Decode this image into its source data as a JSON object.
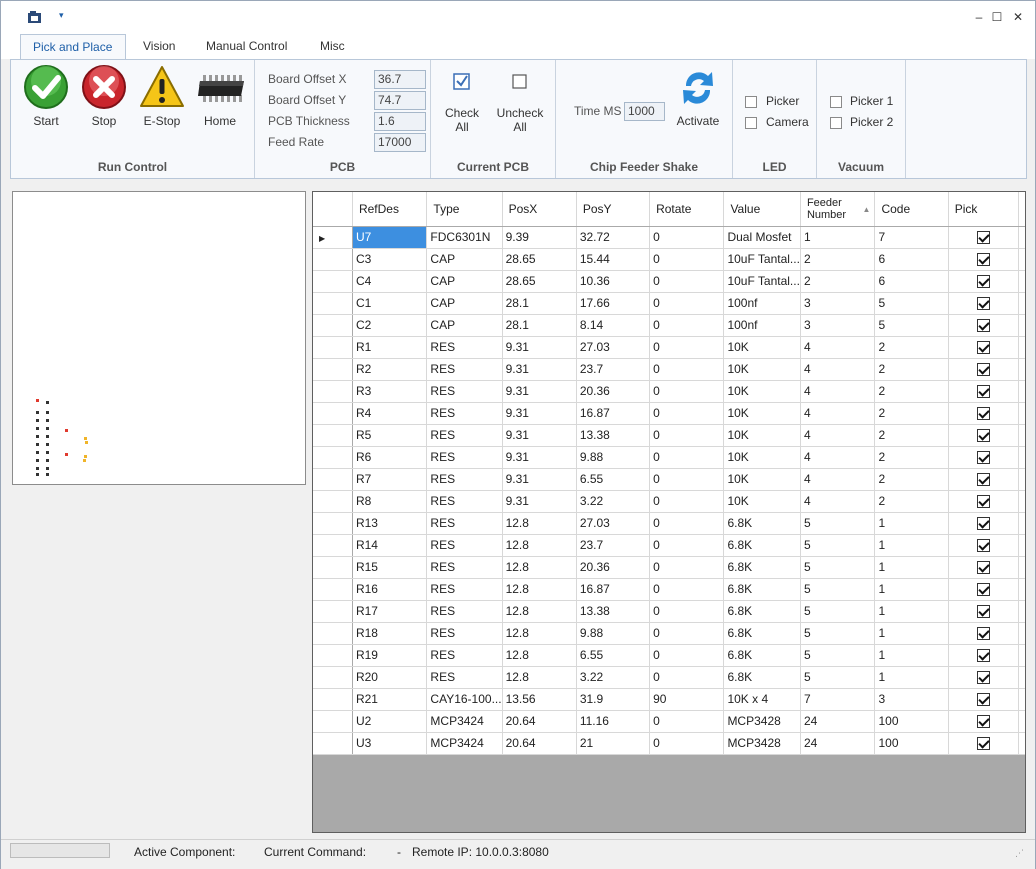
{
  "tabs": [
    "Pick and Place",
    "Vision",
    "Manual Control",
    "Misc"
  ],
  "run_control": {
    "label": "Run Control",
    "start": "Start",
    "stop": "Stop",
    "estop": "E-Stop",
    "home": "Home"
  },
  "pcb": {
    "label": "PCB",
    "board_offset_x_label": "Board Offset X",
    "board_offset_x": "36.7",
    "board_offset_y_label": "Board Offset Y",
    "board_offset_y": "74.7",
    "pcb_thickness_label": "PCB Thickness",
    "pcb_thickness": "1.6",
    "feed_rate_label": "Feed Rate",
    "feed_rate": "17000"
  },
  "current_pcb": {
    "label": "Current PCB",
    "check_all_line1": "Check",
    "check_all_line2": "All",
    "uncheck_all_line1": "Uncheck",
    "uncheck_all_line2": "All"
  },
  "chip_feeder": {
    "label": "Chip Feeder Shake",
    "time_ms_label": "Time MS",
    "time_ms": "1000",
    "activate": "Activate"
  },
  "led": {
    "label": "LED",
    "picker": "Picker",
    "camera": "Camera"
  },
  "vacuum": {
    "label": "Vacuum",
    "picker1": "Picker 1",
    "picker2": "Picker 2"
  },
  "grid": {
    "columns": [
      "RefDes",
      "Type",
      "PosX",
      "PosY",
      "Rotate",
      "Value",
      "Feeder Number",
      "Code",
      "Pick"
    ],
    "rows": [
      [
        "U7",
        "FDC6301N",
        "9.39",
        "32.72",
        "0",
        "Dual Mosfet",
        "1",
        "7",
        true
      ],
      [
        "C3",
        "CAP",
        "28.65",
        "15.44",
        "0",
        "10uF Tantal...",
        "2",
        "6",
        true
      ],
      [
        "C4",
        "CAP",
        "28.65",
        "10.36",
        "0",
        "10uF Tantal...",
        "2",
        "6",
        true
      ],
      [
        "C1",
        "CAP",
        "28.1",
        "17.66",
        "0",
        "100nf",
        "3",
        "5",
        true
      ],
      [
        "C2",
        "CAP",
        "28.1",
        "8.14",
        "0",
        "100nf",
        "3",
        "5",
        true
      ],
      [
        "R1",
        "RES",
        "9.31",
        "27.03",
        "0",
        "10K",
        "4",
        "2",
        true
      ],
      [
        "R2",
        "RES",
        "9.31",
        "23.7",
        "0",
        "10K",
        "4",
        "2",
        true
      ],
      [
        "R3",
        "RES",
        "9.31",
        "20.36",
        "0",
        "10K",
        "4",
        "2",
        true
      ],
      [
        "R4",
        "RES",
        "9.31",
        "16.87",
        "0",
        "10K",
        "4",
        "2",
        true
      ],
      [
        "R5",
        "RES",
        "9.31",
        "13.38",
        "0",
        "10K",
        "4",
        "2",
        true
      ],
      [
        "R6",
        "RES",
        "9.31",
        "9.88",
        "0",
        "10K",
        "4",
        "2",
        true
      ],
      [
        "R7",
        "RES",
        "9.31",
        "6.55",
        "0",
        "10K",
        "4",
        "2",
        true
      ],
      [
        "R8",
        "RES",
        "9.31",
        "3.22",
        "0",
        "10K",
        "4",
        "2",
        true
      ],
      [
        "R13",
        "RES",
        "12.8",
        "27.03",
        "0",
        "6.8K",
        "5",
        "1",
        true
      ],
      [
        "R14",
        "RES",
        "12.8",
        "23.7",
        "0",
        "6.8K",
        "5",
        "1",
        true
      ],
      [
        "R15",
        "RES",
        "12.8",
        "20.36",
        "0",
        "6.8K",
        "5",
        "1",
        true
      ],
      [
        "R16",
        "RES",
        "12.8",
        "16.87",
        "0",
        "6.8K",
        "5",
        "1",
        true
      ],
      [
        "R17",
        "RES",
        "12.8",
        "13.38",
        "0",
        "6.8K",
        "5",
        "1",
        true
      ],
      [
        "R18",
        "RES",
        "12.8",
        "9.88",
        "0",
        "6.8K",
        "5",
        "1",
        true
      ],
      [
        "R19",
        "RES",
        "12.8",
        "6.55",
        "0",
        "6.8K",
        "5",
        "1",
        true
      ],
      [
        "R20",
        "RES",
        "12.8",
        "3.22",
        "0",
        "6.8K",
        "5",
        "1",
        true
      ],
      [
        "R21",
        "CAY16-100...",
        "13.56",
        "31.9",
        "90",
        "10K x 4",
        "7",
        "3",
        true
      ],
      [
        "U2",
        "MCP3424",
        "20.64",
        "11.16",
        "0",
        "MCP3428",
        "24",
        "100",
        true
      ],
      [
        "U3",
        "MCP3424",
        "20.64",
        "21",
        "0",
        "MCP3428",
        "24",
        "100",
        true
      ]
    ]
  },
  "status": {
    "active_component": "Active Component:",
    "current_command": "Current Command:",
    "separator": "-",
    "remote_ip": "Remote IP: 10.0.0.3:8080"
  },
  "colors": {
    "accent": "#1e5fa8",
    "selection": "#3d8fe0",
    "grid_empty": "#a9a9a9"
  }
}
